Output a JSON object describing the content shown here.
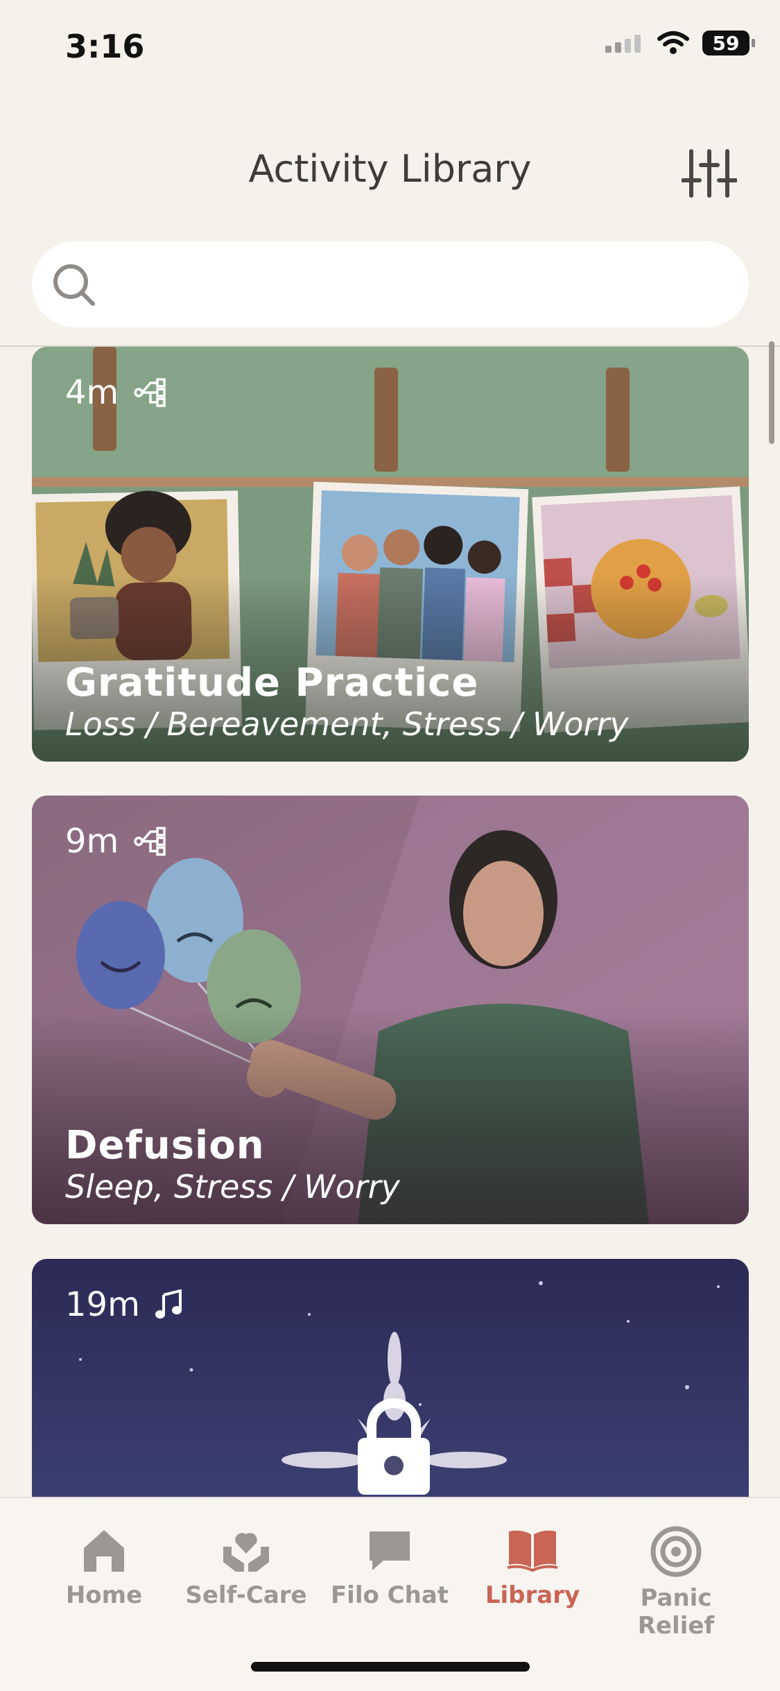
{
  "status_bar": {
    "time": "3:16",
    "battery": "59"
  },
  "header": {
    "title": "Activity Library",
    "filter_icon": "sliders-icon"
  },
  "search": {
    "placeholder": "",
    "value": "",
    "icon": "search-icon"
  },
  "cards": [
    {
      "duration": "4m",
      "type_icon": "branch-icon",
      "title": "Gratitude Practice",
      "tags": "Loss / Bereavement, Stress / Worry"
    },
    {
      "duration": "9m",
      "type_icon": "branch-icon",
      "title": "Defusion",
      "tags": "Sleep, Stress / Worry"
    },
    {
      "duration": "19m",
      "type_icon": "music-note-icon",
      "locked": true,
      "lock_icon": "lock-icon"
    }
  ],
  "tabs": [
    {
      "label": "Home",
      "icon": "home-icon",
      "active": false
    },
    {
      "label": "Self-Care",
      "icon": "heart-hands-icon",
      "active": false
    },
    {
      "label": "Filo Chat",
      "icon": "chat-bubble-icon",
      "active": false
    },
    {
      "label": "Library",
      "icon": "open-book-icon",
      "active": true
    },
    {
      "label": "Panic Relief",
      "icon": "target-icon",
      "active": false
    }
  ],
  "colors": {
    "accent": "#c96555",
    "inactive": "#9b9893",
    "background": "#f5f1eb"
  }
}
